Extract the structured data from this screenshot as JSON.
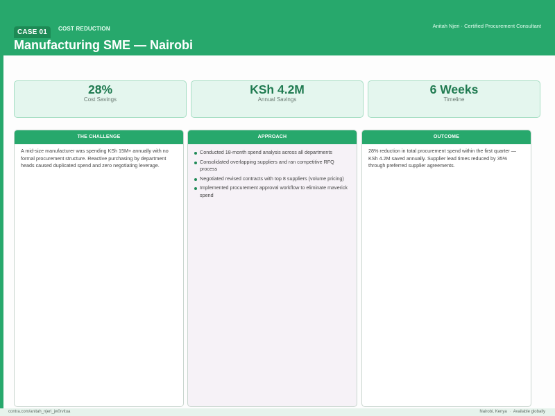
{
  "header": {
    "case_tag": "CASE 01",
    "category": "COST REDUCTION",
    "consultant_name": "Anitah Njeri",
    "consultant_sep": "·",
    "consultant_title": "Certified Procurement Consultant",
    "title": "Manufacturing SME — Nairobi"
  },
  "stats": [
    {
      "value": "28%",
      "label": "Cost Savings"
    },
    {
      "value": "KSh 4.2M",
      "label": "Annual Savings"
    },
    {
      "value": "6 Weeks",
      "label": "Timeline"
    }
  ],
  "challenge": {
    "heading": "THE CHALLENGE",
    "text": "A mid-size manufacturer was spending KSh 15M+ annually with no formal procurement structure. Reactive purchasing by department heads caused duplicated spend and zero negotiating leverage."
  },
  "approach": {
    "heading": "APPROACH",
    "steps": [
      "Conducted 18-month spend analysis across all departments",
      "Consolidated overlapping suppliers and ran competitive RFQ process",
      "Negotiated revised contracts with top 8 suppliers (volume pricing)",
      "Implemented procurement approval workflow to eliminate maverick spend"
    ]
  },
  "outcome": {
    "heading": "OUTCOME",
    "text": "28% reduction in total procurement spend within the first quarter — KSh 4.2M saved annually. Supplier lead times reduced by 35% through preferred supplier agreements."
  },
  "footer": {
    "url": "contra.com/anitah_njeri_jw0rvitua",
    "location": "Nairobi, Kenya",
    "sep": "·",
    "availability": "Available globally"
  },
  "colors": {
    "brand_green": "#27a86c",
    "dark_green": "#1d8a55",
    "stat_bg": "#e4f6ee",
    "approach_bg": "#f6f2f7"
  }
}
